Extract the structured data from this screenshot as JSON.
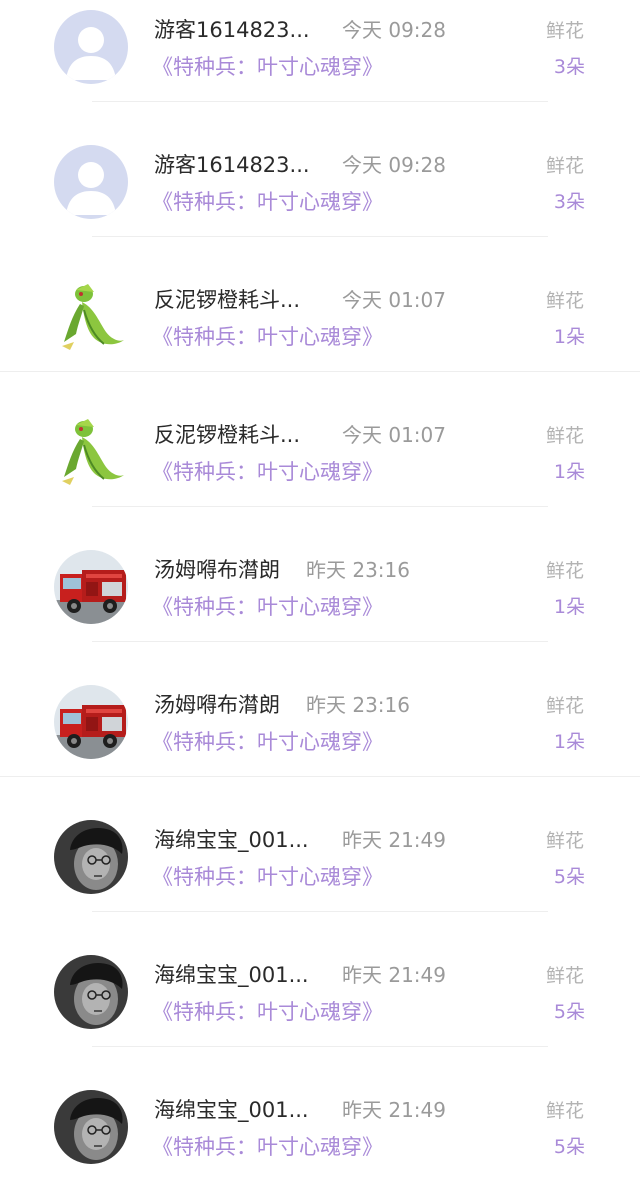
{
  "rows": [
    {
      "avatar": "default-avatar-icon",
      "name": "游客1614823...",
      "time": "今天 09:28",
      "book": "《特种兵：叶寸心魂穿》",
      "gift": "鲜花",
      "count": "3朵"
    },
    {
      "avatar": "default-avatar-icon",
      "name": "游客1614823...",
      "time": "今天 09:28",
      "book": "《特种兵：叶寸心魂穿》",
      "gift": "鲜花",
      "count": "3朵"
    },
    {
      "avatar": "green-creature-avatar",
      "name": "反泥锣橙耗斗...",
      "time": "今天 01:07",
      "book": "《特种兵：叶寸心魂穿》",
      "gift": "鲜花",
      "count": "1朵"
    },
    {
      "avatar": "green-creature-avatar",
      "name": "反泥锣橙耗斗...",
      "time": "今天 01:07",
      "book": "《特种兵：叶寸心魂穿》",
      "gift": "鲜花",
      "count": "1朵"
    },
    {
      "avatar": "fire-truck-avatar",
      "name": "汤姆嘚布潸朗",
      "time": "昨天 23:16",
      "book": "《特种兵：叶寸心魂穿》",
      "gift": "鲜花",
      "count": "1朵"
    },
    {
      "avatar": "fire-truck-avatar",
      "name": "汤姆嘚布潸朗",
      "time": "昨天 23:16",
      "book": "《特种兵：叶寸心魂穿》",
      "gift": "鲜花",
      "count": "1朵"
    },
    {
      "avatar": "person-photo-avatar",
      "name": "海绵宝宝_001...",
      "time": "昨天 21:49",
      "book": "《特种兵：叶寸心魂穿》",
      "gift": "鲜花",
      "count": "5朵"
    },
    {
      "avatar": "person-photo-avatar",
      "name": "海绵宝宝_001...",
      "time": "昨天 21:49",
      "book": "《特种兵：叶寸心魂穿》",
      "gift": "鲜花",
      "count": "5朵"
    },
    {
      "avatar": "person-photo-avatar",
      "name": "海绵宝宝_001...",
      "time": "昨天 21:49",
      "book": "《特种兵：叶寸心魂穿》",
      "gift": "鲜花",
      "count": "5朵"
    }
  ],
  "colors": {
    "accent_purple": "#a98ad8",
    "name_text": "#2a2a2a",
    "time_text": "#9a9a9a",
    "gift_text": "#b3b3b3",
    "divider": "#eeeeee"
  }
}
